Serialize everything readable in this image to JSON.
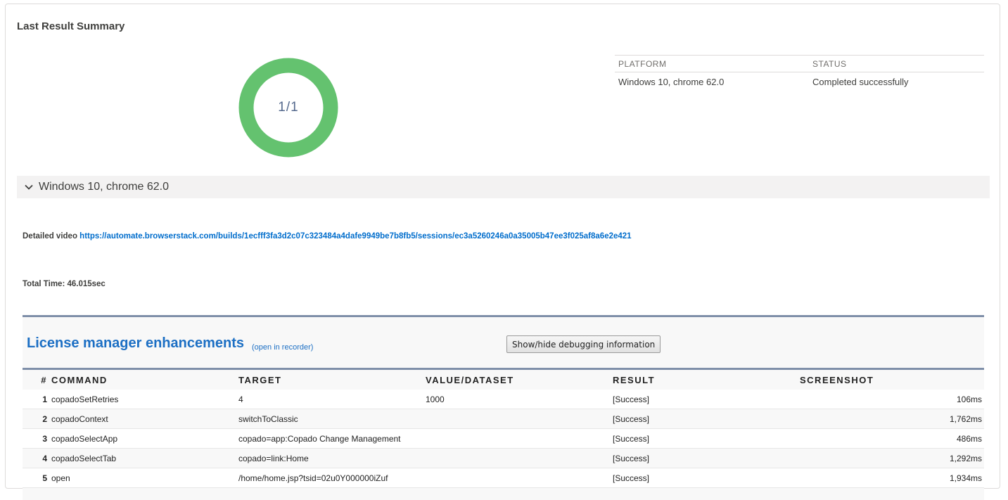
{
  "card": {
    "title": "Last Result Summary"
  },
  "donut": {
    "label": "1/1",
    "passed": 1,
    "total": 1,
    "color": "#64c26f"
  },
  "summary": {
    "headers": [
      "PLATFORM",
      "STATUS"
    ],
    "rows": [
      [
        "Windows 10, chrome 62.0",
        "Completed successfully"
      ]
    ]
  },
  "section": {
    "label": "Windows 10, chrome 62.0",
    "expanded": true,
    "icon": "chevron-down-icon"
  },
  "detail": {
    "label": "Detailed video",
    "url": "https://automate.browserstack.com/builds/1ecfff3fa3d2c07c323484a4dafe9949be7b8fb5/sessions/ec3a5260246a0a35005b47ee3f025af8a6e2e421"
  },
  "total": {
    "text": "Total Time: 46.015sec"
  },
  "suite": {
    "title": "License manager enhancements",
    "open_link": "(open in recorder)",
    "debug_button": "Show/hide debugging information",
    "headers": {
      "num": "#",
      "command": "COMMAND",
      "target": "TARGET",
      "value": "VALUE/DATASET",
      "result": "RESULT",
      "screenshot": "SCREENSHOT"
    },
    "rows": [
      {
        "num": "1",
        "command": "copadoSetRetries",
        "target": "4",
        "value": "1000",
        "result": "[Success]",
        "time": "106ms"
      },
      {
        "num": "2",
        "command": "copadoContext",
        "target": "switchToClassic",
        "value": "",
        "result": "[Success]",
        "time": "1,762ms"
      },
      {
        "num": "3",
        "command": "copadoSelectApp",
        "target": "copado=app:Copado Change Management",
        "value": "",
        "result": "[Success]",
        "time": "486ms"
      },
      {
        "num": "4",
        "command": "copadoSelectTab",
        "target": "copado=link:Home",
        "value": "",
        "result": "[Success]",
        "time": "1,292ms"
      },
      {
        "num": "5",
        "command": "open",
        "target": "/home/home.jsp?tsid=02u0Y000000iZuf",
        "value": "",
        "result": "[Success]",
        "time": "1,934ms"
      }
    ]
  }
}
